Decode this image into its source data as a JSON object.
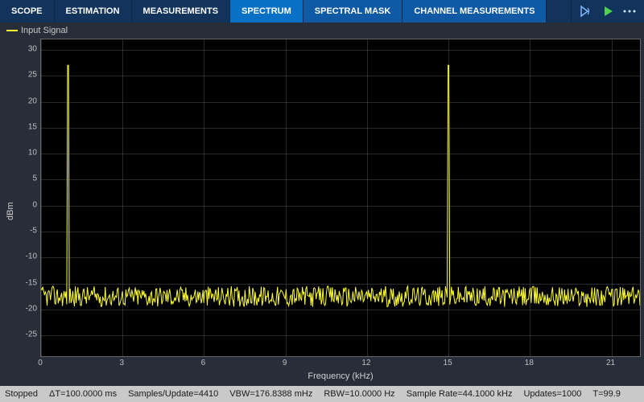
{
  "toolbar": {
    "tabs": [
      {
        "label": "SCOPE",
        "state": "normal"
      },
      {
        "label": "ESTIMATION",
        "state": "normal"
      },
      {
        "label": "MEASUREMENTS",
        "state": "normal"
      },
      {
        "label": "SPECTRUM",
        "state": "active"
      },
      {
        "label": "SPECTRAL MASK",
        "state": "sub-active"
      },
      {
        "label": "CHANNEL MEASUREMENTS",
        "state": "sub-active"
      }
    ]
  },
  "legend": {
    "label": "Input Signal",
    "color": "#ffff33"
  },
  "axes": {
    "xlabel": "Frequency (kHz)",
    "ylabel": "dBm"
  },
  "status": {
    "state": "Stopped",
    "delta_t": "ΔT=100.0000 ms",
    "samples": "Samples/Update=4410",
    "vbw": "VBW=176.8388 mHz",
    "rbw": "RBW=10.0000 Hz",
    "sample_rate": "Sample Rate=44.1000 kHz",
    "updates": "Updates=1000",
    "time": "T=99.9"
  },
  "chart_data": {
    "type": "line",
    "title": "",
    "xlabel": "Frequency (kHz)",
    "ylabel": "dBm",
    "xlim": [
      0,
      22.05
    ],
    "ylim": [
      -29,
      32
    ],
    "xticks": [
      0,
      3,
      6,
      9,
      12,
      15,
      18,
      21
    ],
    "yticks": [
      -25,
      -20,
      -15,
      -10,
      -5,
      0,
      5,
      10,
      15,
      20,
      25,
      30
    ],
    "series": [
      {
        "name": "Input Signal",
        "color": "#ffff33",
        "noise_floor_dbm": -17.5,
        "noise_std_dbm": 2.0,
        "peaks": [
          {
            "freq_khz": 1.0,
            "level_dbm": 27
          },
          {
            "freq_khz": 15.0,
            "level_dbm": 27
          }
        ]
      }
    ]
  }
}
